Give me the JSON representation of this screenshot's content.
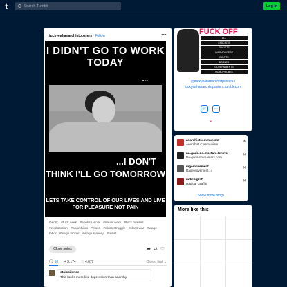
{
  "topbar": {
    "logo": "t",
    "search_placeholder": "Search Tumblr",
    "login_label": "Log In"
  },
  "post": {
    "blogname": "fuckyeahanarchistposters",
    "follow_label": "Follow",
    "more_label": "•••",
    "poster": {
      "headline": "I DIDN'T GO TO WORK TODAY",
      "ellipsis": "...",
      "line_dont": "...I DON'T",
      "line_tomorrow": "THINK I'LL GO TOMORROW",
      "line_lets": "LETS TAKE CONTROL OF OUR LIVES AND LIVE FOR PLEASURE NOT PAIN"
    },
    "tags": [
      "#work",
      "#fuck work",
      "#abolish work",
      "#never work",
      "#fuck bosses",
      "#exploitation",
      "#anarchism",
      "#class",
      "#class struggle",
      "#class war",
      "#wage labor",
      "#wage labour",
      "#wage slavery",
      "#resist"
    ],
    "close_notes_label": "Close notes",
    "stats": {
      "replies": "10",
      "reblogs": "3,174",
      "likes": "4,677",
      "sort_label": "Oldest first ⌄"
    },
    "reply": {
      "user": "stoicsilence",
      "text": "This looks more like depression than anarchy"
    }
  },
  "blog_card": {
    "banner_title": "FUCK OFF",
    "banner_lines": [
      "ALL",
      "FASCISTS",
      "RACISTS",
      "WARMONGERS",
      "BIGOTS",
      "BOSSES",
      "GOVERNMENTS",
      "HOMOPHOBES"
    ],
    "link1": "@fuckyeahanarchistposters /",
    "link2": "fuckyeahanarchistposters.tumblr.com",
    "chevron": "⌄"
  },
  "blogs": [
    {
      "name": "anarchistcommunism",
      "title": "Anarchist Communism"
    },
    {
      "name": "no-gods-no-masters-tshirts",
      "title": "No-gods-no-masters.com"
    },
    {
      "name": "ragemovement",
      "title": "RageMovement. ✓"
    },
    {
      "name": "radicalgraff",
      "title": "Radical Graffiti"
    }
  ],
  "show_more_label": "Show more blogs",
  "more_like_title": "More like this"
}
